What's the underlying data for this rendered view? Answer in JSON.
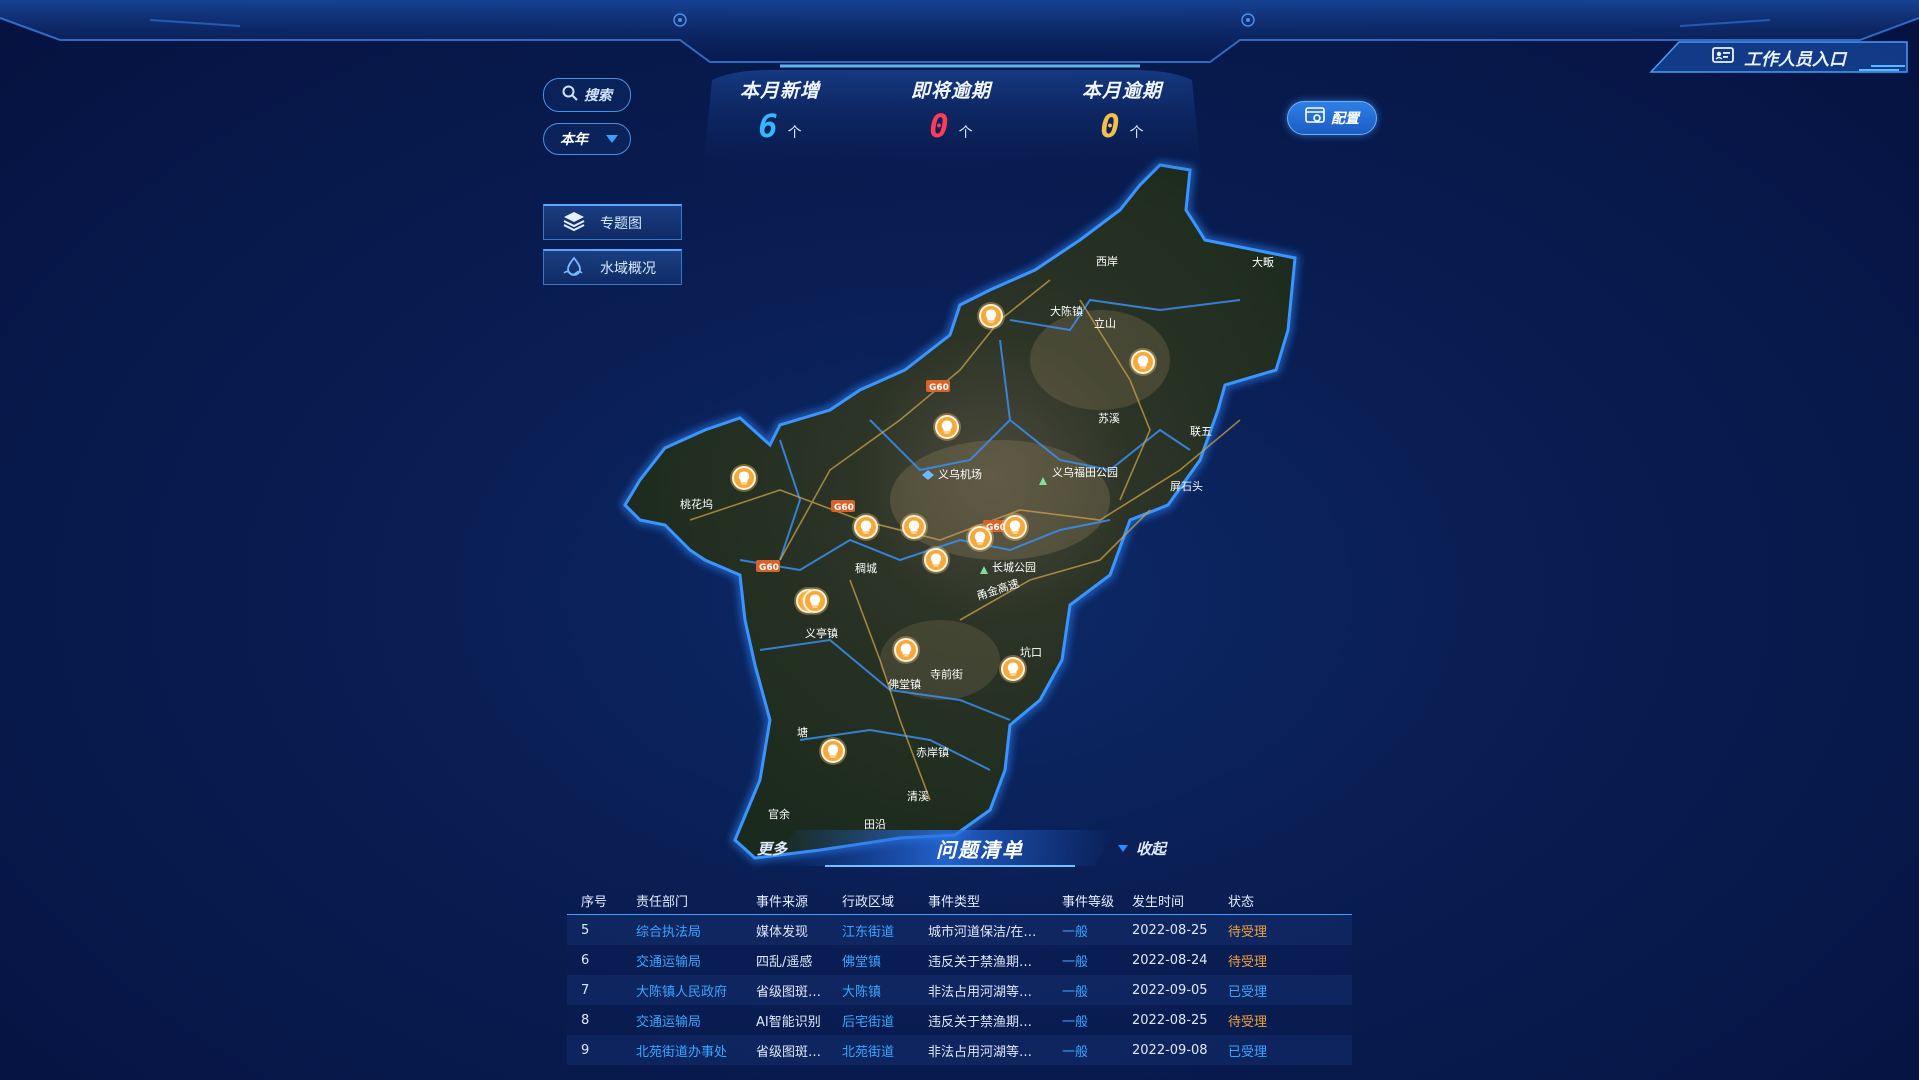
{
  "header": {
    "worker_entry_label": "工作人员入口"
  },
  "controls": {
    "search_label": "搜索",
    "year_select_value": "本年",
    "config_label": "配置"
  },
  "sidebar": {
    "items": [
      {
        "label": "专题图",
        "icon": "layers-icon"
      },
      {
        "label": "水域概况",
        "icon": "water-icon"
      }
    ]
  },
  "stats": [
    {
      "label": "本月新增",
      "value": "6",
      "unit": "个",
      "color": "#36b6ff"
    },
    {
      "label": "即将逾期",
      "value": "0",
      "unit": "个",
      "color": "#ff3b5c"
    },
    {
      "label": "本月逾期",
      "value": "0",
      "unit": "个",
      "color": "#f4c04a"
    }
  ],
  "map": {
    "place_labels": [
      "西岸",
      "大畈",
      "大陈镇",
      "立山",
      "苏溪",
      "联五",
      "义乌机场",
      "义乌福田公园",
      "屏石头",
      "桃花坞",
      "稠城",
      "长城公园",
      "甬金高速",
      "义亭镇",
      "佛堂镇",
      "寺前街",
      "坑口",
      "赤岸镇",
      "清溪",
      "塘",
      "官余",
      "田沿"
    ],
    "road_badges": [
      "G60",
      "G60",
      "G60",
      "G60"
    ],
    "marker_icon": "location-pin-icon",
    "marker_color": "#f7a83a"
  },
  "issue_list": {
    "more_label": "更多",
    "title": "问题清单",
    "collapse_label": "收起",
    "columns": [
      "序号",
      "责任部门",
      "事件来源",
      "行政区域",
      "事件类型",
      "事件等级",
      "发生时间",
      "状态"
    ],
    "rows": [
      {
        "no": "5",
        "dept": "综合执法局",
        "source": "媒体发现",
        "region": "江东街道",
        "type": "城市河道保洁/在…",
        "level": "一般",
        "time": "2022-08-25",
        "status": "待受理"
      },
      {
        "no": "6",
        "dept": "交通运输局",
        "source": "四乱/遥感",
        "region": "佛堂镇",
        "type": "违反关于禁渔期…",
        "level": "一般",
        "time": "2022-08-24",
        "status": "待受理"
      },
      {
        "no": "7",
        "dept": "大陈镇人民政府",
        "source": "省级图斑…",
        "region": "大陈镇",
        "type": "非法占用河湖等…",
        "level": "一般",
        "time": "2022-09-05",
        "status": "已受理"
      },
      {
        "no": "8",
        "dept": "交通运输局",
        "source": "AI智能识别",
        "region": "后宅街道",
        "type": "违反关于禁渔期…",
        "level": "一般",
        "time": "2022-08-25",
        "status": "待受理"
      },
      {
        "no": "9",
        "dept": "北苑街道办事处",
        "source": "省级图斑…",
        "region": "北苑街道",
        "type": "非法占用河湖等…",
        "level": "一般",
        "time": "2022-09-08",
        "status": "已受理"
      }
    ]
  }
}
